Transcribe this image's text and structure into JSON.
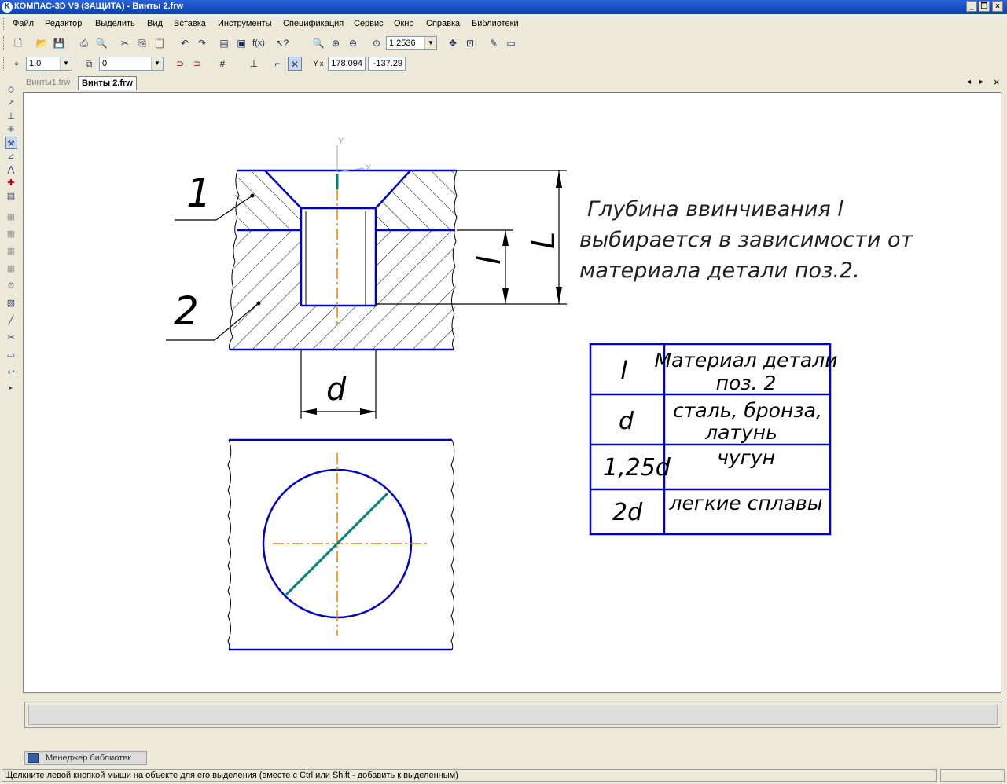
{
  "window": {
    "title": "КОМПАС-3D V9 (ЗАЩИТА) - Винты 2.frw",
    "logo_letter": "K",
    "controls": [
      "_",
      "❐",
      "×"
    ]
  },
  "menu": [
    "Файл",
    "Редактор",
    "Выделить",
    "Вид",
    "Вставка",
    "Инструменты",
    "Спецификация",
    "Сервис",
    "Окно",
    "Справка",
    "Библиотеки"
  ],
  "toolbar": {
    "zoom_value": "1.2536",
    "line_scale": "1.0",
    "layer_value": "0",
    "coord_label": "Y x",
    "coord_x": "178.094",
    "coord_y": "-137.29"
  },
  "tabs": [
    {
      "label": "Винты1.frw",
      "active": false
    },
    {
      "label": "Винты 2.frw",
      "active": true
    }
  ],
  "drawing": {
    "axis_y_label": "Y",
    "axis_x_label": "X",
    "pos1": "1",
    "pos2": "2",
    "dim_d": "d",
    "dim_l_small": "l",
    "dim_L_big": "L",
    "note_lines": [
      "Глубина ввинчивания l",
      "выбирается в зависимости от",
      "материала детали поз.2."
    ],
    "table": {
      "header": [
        "l",
        "Материал детали поз. 2"
      ],
      "rows": [
        [
          "d",
          "сталь, бронза, латунь"
        ],
        [
          "1,25d",
          "чугун"
        ],
        [
          "2d",
          "легкие сплавы"
        ]
      ]
    },
    "colors": {
      "contour": "#0000c0",
      "axis": "#e08000",
      "thread": "#008080"
    }
  },
  "library_manager": "Менеджер библиотек",
  "status": "Щелкните левой кнопкой мыши на объекте для его выделения (вместе с Ctrl или Shift - добавить к выделенным)"
}
